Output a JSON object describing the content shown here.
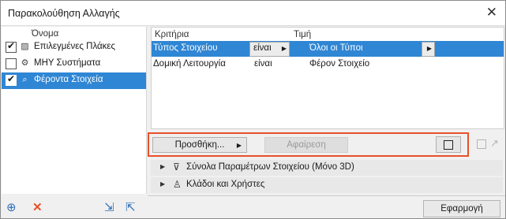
{
  "window": {
    "title": "Παρακολούθηση Αλλαγής",
    "close_glyph": "✕"
  },
  "left_panel": {
    "header": "Όνομα",
    "items": [
      {
        "label": "Επιλεγμένες Πλάκες",
        "checked": true,
        "icon": "slab-icon",
        "glyph": "▨",
        "selected": false
      },
      {
        "label": "ΜΗΥ Συστήματα",
        "checked": false,
        "icon": "mep-systems-icon",
        "glyph": "⚙",
        "selected": false
      },
      {
        "label": "Φέροντα Στοιχεία",
        "checked": true,
        "icon": "structural-search-icon",
        "glyph": "⌕",
        "selected": true
      }
    ]
  },
  "criteria": {
    "headers": {
      "criteria": "Κριτήρια",
      "value": "Τιμή"
    },
    "rows": [
      {
        "criterion": "Τύπος Στοιχείου",
        "operator": "είναι",
        "value": "Όλοι οι Τύποι",
        "selected": true
      },
      {
        "criterion": "Δομική Λειτουργία",
        "operator": "είναι",
        "value": "Φέρον Στοιχείο",
        "selected": false
      }
    ]
  },
  "toolbar": {
    "add_label": "Προσθήκη...",
    "remove_label": "Αφαίρεση"
  },
  "sections": [
    {
      "label": "Σύνολα Παραμέτρων Στοιχείου (Μόνο 3D)",
      "icon": "filter-icon",
      "glyph": "⊽"
    },
    {
      "label": "Κλάδοι και Χρήστες",
      "icon": "user-icon",
      "glyph": "♙"
    }
  ],
  "footer": {
    "apply_label": "Εφαρμογή"
  },
  "colors": {
    "selection": "#2f86d4",
    "highlight_border": "#e8502a",
    "delete": "#e8502a"
  }
}
